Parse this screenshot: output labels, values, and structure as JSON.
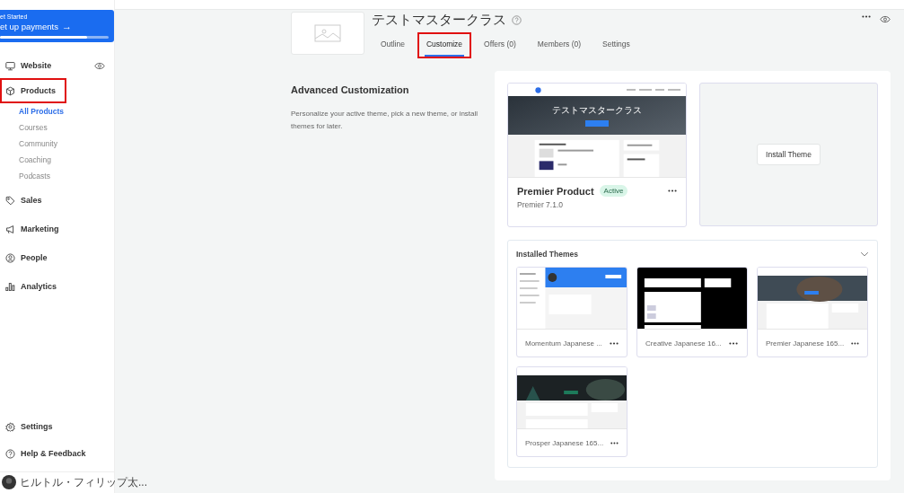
{
  "setup_card": {
    "eyebrow": "et Started",
    "title": "et up payments",
    "arrow": "→",
    "level": 0.8
  },
  "nav": [
    {
      "label": "Website",
      "kind": "monitor",
      "highlighted": false,
      "preview": true
    },
    {
      "label": "Products",
      "kind": "box",
      "highlighted": true,
      "preview": false,
      "children": [
        {
          "label": "All Products",
          "selected": true
        },
        {
          "label": "Courses",
          "selected": false
        },
        {
          "label": "Community",
          "selected": false
        },
        {
          "label": "Coaching",
          "selected": false
        },
        {
          "label": "Podcasts",
          "selected": false
        }
      ]
    },
    {
      "label": "Sales",
      "kind": "tag",
      "highlighted": false,
      "preview": false
    },
    {
      "label": "Marketing",
      "kind": "megaphone",
      "highlighted": false,
      "preview": false
    },
    {
      "label": "People",
      "kind": "person",
      "highlighted": false,
      "preview": false
    },
    {
      "label": "Analytics",
      "kind": "bars",
      "highlighted": false,
      "preview": false
    }
  ],
  "nav_bottom": [
    {
      "label": "Settings",
      "kind": "gear"
    },
    {
      "label": "Help & Feedback",
      "kind": "help"
    }
  ],
  "user": {
    "name": "ヒルトル・フィリップ太..."
  },
  "product": {
    "title": "テストマスタークラス"
  },
  "tabs": [
    {
      "label": "Outline",
      "selected": false,
      "highlighted": false
    },
    {
      "label": "Customize",
      "selected": true,
      "highlighted": true
    },
    {
      "label": "Offers (0)",
      "selected": false,
      "highlighted": false
    },
    {
      "label": "Members (0)",
      "selected": false,
      "highlighted": false
    },
    {
      "label": "Settings",
      "selected": false,
      "highlighted": false
    }
  ],
  "section": {
    "heading": "Advanced Customization",
    "description": "Personalize your active theme, pick a new theme, or install themes for later."
  },
  "active_theme": {
    "name": "Premier Product",
    "badge": "Active",
    "version": "Premier 7.1.0",
    "preview_title": "テストマスタークラス"
  },
  "install_button": "Install Theme",
  "installed": {
    "title": "Installed Themes",
    "expanded": true,
    "themes": [
      {
        "name": "Momentum Japanese ...",
        "kind": "momentum"
      },
      {
        "name": "Creative Japanese 16...",
        "kind": "creative"
      },
      {
        "name": "Premier Japanese 165...",
        "kind": "premier"
      },
      {
        "name": "Prosper Japanese 165...",
        "kind": "prosper"
      }
    ]
  }
}
